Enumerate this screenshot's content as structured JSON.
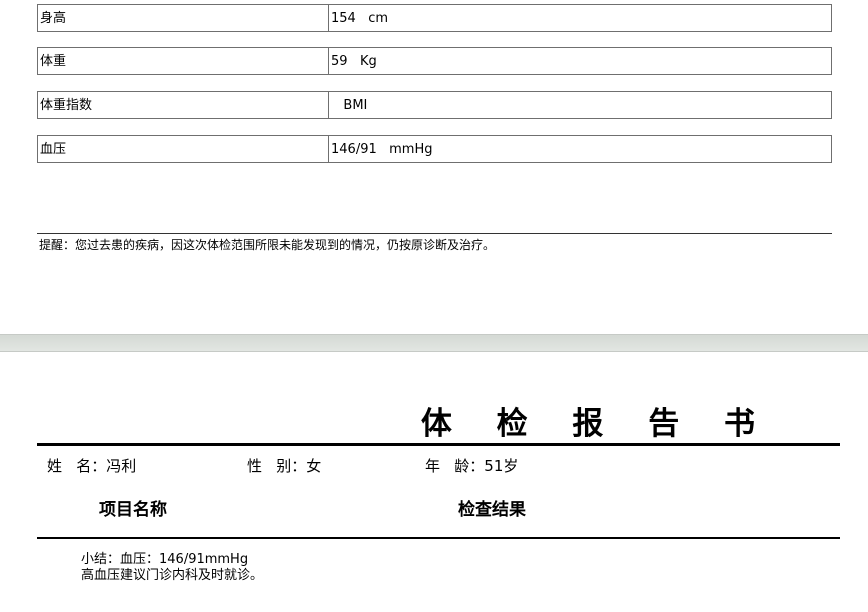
{
  "measurements": [
    {
      "label": "身高",
      "value": "154   cm"
    },
    {
      "label": "体重",
      "value": "59   Kg"
    },
    {
      "label": "体重指数",
      "value": "   BMI"
    },
    {
      "label": "血压",
      "value": "146/91   mmHg"
    }
  ],
  "reminder": "提醒：您过去患的疾病，因这次体检范围所限未能发现到的情况，仍按原诊断及治疗。",
  "report": {
    "title": "体 检 报 告 书",
    "name": "姓   名：冯利",
    "gender": "性   别：女",
    "age": "年   龄：51岁",
    "col_item": "项目名称",
    "col_result": "检查结果",
    "summary_line1": "小结：血压：146/91mmHg",
    "summary_line2": "高血压建议门诊内科及时就诊。"
  }
}
